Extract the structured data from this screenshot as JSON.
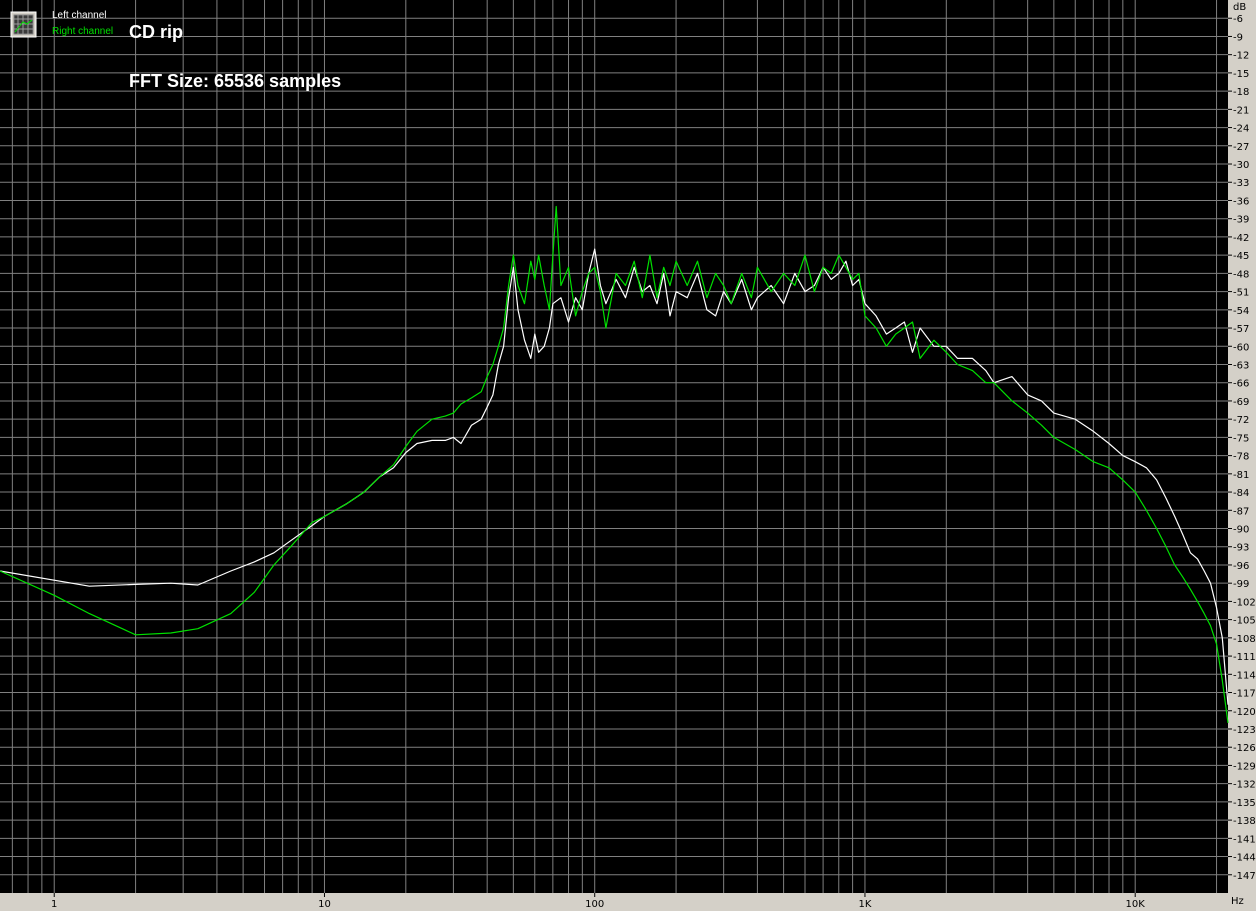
{
  "legend": {
    "items": [
      {
        "label": "Left channel",
        "color": "#ffffff"
      },
      {
        "label": "Right channel",
        "color": "#00e000"
      }
    ],
    "icon": "spectrum-grid-icon"
  },
  "annotations": {
    "title": "CD rip",
    "fft": "FFT Size: 65536 samples"
  },
  "chart_data": {
    "type": "line",
    "title": "CD rip",
    "subtitle": "FFT Size: 65536 samples",
    "x_unit": "Hz",
    "y_unit": "dB",
    "x_scale": "log",
    "xlim": [
      0.63,
      22050
    ],
    "ylim": [
      -150,
      -3
    ],
    "grid": true,
    "legend_position": "top-left",
    "background": "#000000",
    "grid_color": "#808080",
    "x_ticks": [
      {
        "value": 1,
        "label": "1"
      },
      {
        "value": 10,
        "label": "10"
      },
      {
        "value": 100,
        "label": "100"
      },
      {
        "value": 1000,
        "label": "1K"
      },
      {
        "value": 10000,
        "label": "10K"
      }
    ],
    "y_ticks": [
      -6,
      -9,
      -12,
      -15,
      -18,
      -21,
      -24,
      -27,
      -30,
      -33,
      -36,
      -39,
      -42,
      -45,
      -48,
      -51,
      -54,
      -57,
      -60,
      -63,
      -66,
      -69,
      -72,
      -75,
      -78,
      -81,
      -84,
      -87,
      -90,
      -93,
      -96,
      -99,
      -102,
      -105,
      -108,
      -111,
      -114,
      -117,
      -120,
      -123,
      -126,
      -129,
      -132,
      -135,
      -138,
      -141,
      -144,
      -147
    ],
    "series": [
      {
        "name": "Left channel",
        "color": "#ffffff",
        "x": [
          0.63,
          1.35,
          2.0,
          2.7,
          3.4,
          4.5,
          5.5,
          6.5,
          7.5,
          9,
          10,
          12,
          14,
          16,
          18,
          20,
          22,
          25,
          28,
          30,
          32,
          35,
          38,
          40,
          42,
          44,
          46,
          48,
          50,
          52,
          55,
          58,
          60,
          62,
          65,
          68,
          70,
          75,
          80,
          85,
          90,
          95,
          100,
          105,
          110,
          120,
          130,
          140,
          150,
          160,
          170,
          180,
          190,
          200,
          220,
          240,
          260,
          280,
          300,
          320,
          350,
          380,
          400,
          450,
          500,
          550,
          600,
          650,
          700,
          750,
          800,
          850,
          900,
          950,
          1000,
          1100,
          1200,
          1300,
          1400,
          1500,
          1600,
          1800,
          2000,
          2200,
          2500,
          2800,
          3000,
          3500,
          4000,
          4500,
          5000,
          6000,
          7000,
          8000,
          9000,
          10000,
          11000,
          12000,
          13000,
          14000,
          15000,
          16000,
          17000,
          18000,
          19000,
          20000,
          21000,
          22050
        ],
        "y": [
          -97,
          -99.5,
          -99.2,
          -99,
          -99.3,
          -97,
          -95.5,
          -94,
          -92,
          -89.5,
          -88,
          -86,
          -84,
          -81.5,
          -80,
          -77.5,
          -76,
          -75.5,
          -75.5,
          -75,
          -76,
          -73,
          -72,
          -70,
          -68,
          -63,
          -60,
          -52,
          -47,
          -54,
          -59,
          -62,
          -58,
          -61,
          -60,
          -57,
          -53,
          -52,
          -56,
          -52,
          -54,
          -48,
          -44,
          -50,
          -53,
          -49,
          -52,
          -47,
          -51,
          -50,
          -53,
          -48,
          -55,
          -51,
          -52,
          -48,
          -54,
          -55,
          -51,
          -53,
          -49,
          -54,
          -52,
          -50,
          -53,
          -48,
          -51,
          -50,
          -47,
          -49,
          -48,
          -46,
          -50,
          -49,
          -53,
          -55,
          -58,
          -57,
          -56,
          -61,
          -57,
          -60,
          -60,
          -62,
          -62,
          -64,
          -66,
          -65,
          -68,
          -69,
          -71,
          -72,
          -74,
          -76,
          -78,
          -79,
          -80,
          -82,
          -85,
          -88,
          -91,
          -94,
          -95,
          -97,
          -99,
          -103,
          -108,
          -119
        ]
      },
      {
        "name": "Right channel",
        "color": "#00e000",
        "x": [
          0.63,
          1.0,
          1.35,
          2.0,
          2.7,
          3.4,
          4.5,
          5.5,
          6.5,
          7.5,
          9,
          10,
          12,
          14,
          16,
          18,
          20,
          22,
          25,
          28,
          30,
          32,
          35,
          38,
          40,
          42,
          44,
          46,
          48,
          50,
          52,
          55,
          58,
          60,
          62,
          65,
          68,
          70,
          72,
          75,
          80,
          85,
          90,
          95,
          100,
          105,
          110,
          120,
          130,
          140,
          150,
          160,
          170,
          180,
          190,
          200,
          220,
          240,
          260,
          280,
          300,
          320,
          350,
          380,
          400,
          450,
          500,
          550,
          600,
          650,
          700,
          750,
          800,
          850,
          900,
          950,
          1000,
          1100,
          1200,
          1300,
          1400,
          1500,
          1600,
          1800,
          2000,
          2200,
          2500,
          2800,
          3000,
          3500,
          4000,
          4500,
          5000,
          6000,
          7000,
          8000,
          9000,
          10000,
          11000,
          12000,
          13000,
          14000,
          15000,
          16000,
          17000,
          18000,
          19000,
          20000,
          21000,
          22050
        ],
        "y": [
          -97,
          -101,
          -104,
          -107.5,
          -107.2,
          -106.5,
          -104,
          -100.5,
          -96,
          -93,
          -89,
          -88,
          -86,
          -84,
          -81.5,
          -79.5,
          -76.5,
          -74,
          -72,
          -71.5,
          -71,
          -69.5,
          -68.5,
          -67.5,
          -65,
          -63,
          -60,
          -57,
          -50,
          -45,
          -50,
          -53,
          -46,
          -49,
          -45,
          -50,
          -54,
          -45,
          -37,
          -50,
          -47,
          -55,
          -51,
          -48,
          -47,
          -51,
          -57,
          -48,
          -50,
          -46,
          -52,
          -45,
          -52,
          -47,
          -50,
          -46,
          -50,
          -46,
          -52,
          -48,
          -50,
          -53,
          -48,
          -52,
          -47,
          -51,
          -48,
          -50,
          -45,
          -51,
          -47,
          -48,
          -45,
          -47,
          -49,
          -48,
          -55,
          -57,
          -60,
          -58,
          -57,
          -56,
          -62,
          -59,
          -61,
          -63,
          -64,
          -66,
          -66,
          -69,
          -71,
          -73,
          -75,
          -77,
          -79,
          -80,
          -82,
          -84,
          -87,
          -90,
          -93,
          -96,
          -98,
          -100,
          -102,
          -104,
          -106,
          -109,
          -115,
          -122
        ]
      }
    ]
  }
}
